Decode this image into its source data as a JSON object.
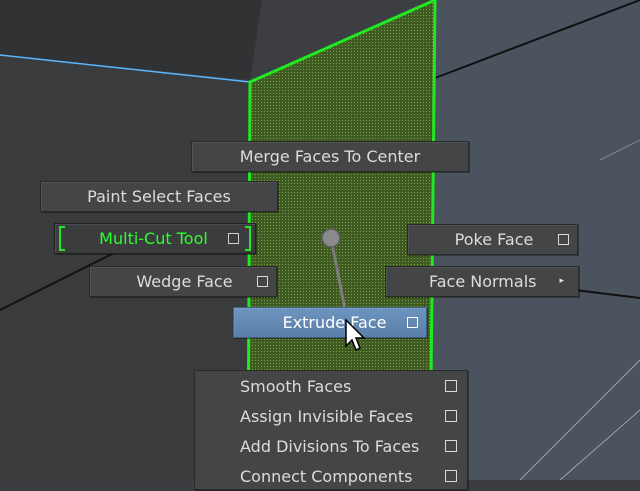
{
  "marking_menu": {
    "north": {
      "label": "Merge Faces To Center"
    },
    "northwest": {
      "label": "Paint Select Faces"
    },
    "west": {
      "label": "Multi-Cut Tool",
      "active": true,
      "has_option_box": true
    },
    "southwest": {
      "label": "Wedge Face",
      "has_option_box": true
    },
    "east": {
      "label": "Poke Face",
      "has_option_box": true
    },
    "southeast": {
      "label": "Face Normals",
      "has_submenu": true
    },
    "south": {
      "label": "Extrude Face",
      "highlighted": true,
      "has_option_box": true
    }
  },
  "overflow_menu": {
    "items": [
      {
        "label": "Smooth Faces"
      },
      {
        "label": "Assign Invisible Faces"
      },
      {
        "label": "Add Divisions To Faces"
      },
      {
        "label": "Connect Components"
      }
    ]
  },
  "icons": {
    "option_box": "option-box-icon",
    "submenu_arrow": "submenu-arrow-icon",
    "cursor": "mouse-cursor-icon"
  },
  "colors": {
    "viewport_bg": "#3b3d40",
    "menu_bg": "#444546",
    "menu_text": "#dcdcdc",
    "active_text": "#2cff2c",
    "highlight_bg": "#5b7fa8",
    "selection_green": "#22e822"
  }
}
